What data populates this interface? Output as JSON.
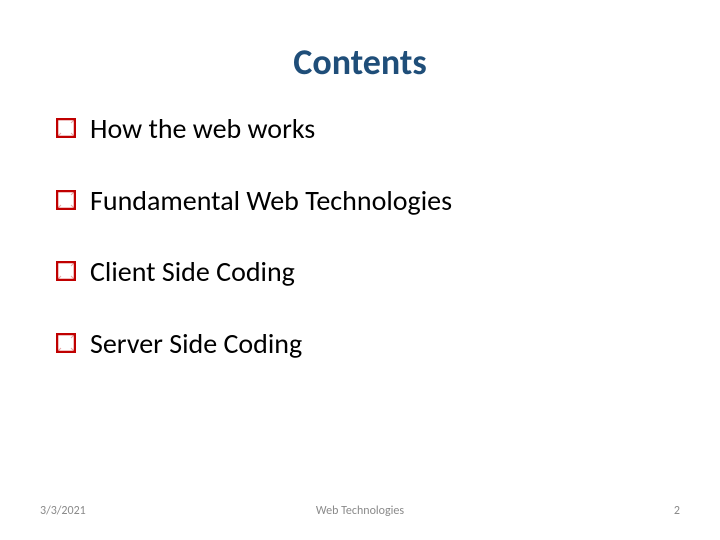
{
  "title": "Contents",
  "bullets": {
    "0": "How the web works",
    "1": "Fundamental Web Technologies",
    "2": "Client Side Coding",
    "3": "Server Side Coding"
  },
  "footer": {
    "date": "3/3/2021",
    "center": "Web Technologies",
    "page": "2"
  },
  "colors": {
    "bullet_box": "#c00000",
    "title": "#1f4e79"
  }
}
